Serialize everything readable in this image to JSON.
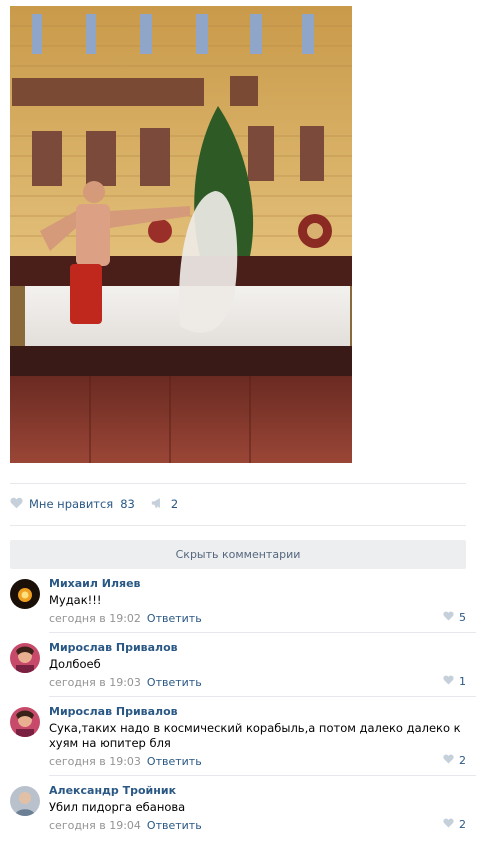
{
  "post": {
    "image_alt": "photo",
    "likes_label": "Мне нравится",
    "likes_count": "83",
    "reposts_count": "2"
  },
  "comments_toggle": "Скрыть комментарии",
  "comments": [
    {
      "author": "Михаил Иляев",
      "text": "Мудак!!!",
      "time": "сегодня в 19:02",
      "reply": "Ответить",
      "likes": "5"
    },
    {
      "author": "Мирослав Привалов",
      "text": "Долбоеб",
      "time": "сегодня в 19:03",
      "reply": "Ответить",
      "likes": "1"
    },
    {
      "author": "Мирослав Привалов",
      "text": "Сука,таких надо в космический корабыль,а потом далеко далеко к хуям на юпитер бля",
      "time": "сегодня в 19:03",
      "reply": "Ответить",
      "likes": "2"
    },
    {
      "author": "Александр Тройник",
      "text": "Убил пидорга ебанова",
      "time": "сегодня в 19:04",
      "reply": "Ответить",
      "likes": "2"
    }
  ],
  "colors": {
    "link": "#2a5885",
    "meta": "#939393",
    "bar": "#edeef0"
  },
  "icons": {
    "like": "heart-icon",
    "repost": "megaphone-icon"
  }
}
